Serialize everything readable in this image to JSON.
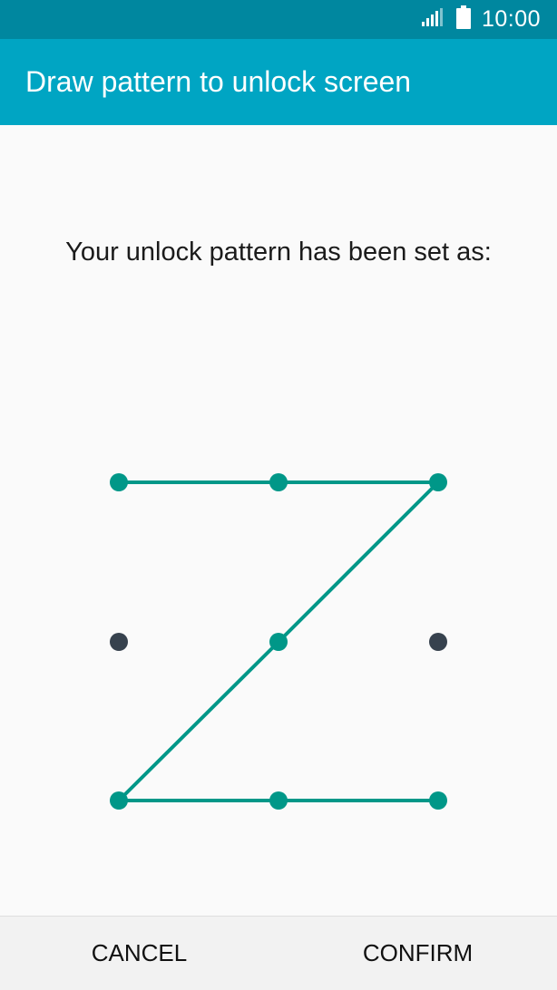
{
  "status_bar": {
    "time": "10:00",
    "icons": [
      "signal-icon",
      "battery-icon"
    ]
  },
  "app_bar": {
    "title": "Draw pattern to unlock screen"
  },
  "main": {
    "message": "Your unlock pattern has been set as:",
    "pattern": {
      "grid_size": 3,
      "sequence": [
        1,
        2,
        3,
        5,
        7,
        8,
        9
      ],
      "active_color": "#009788",
      "inactive_color": "#37424e"
    }
  },
  "buttons": {
    "cancel_label": "CANCEL",
    "confirm_label": "CONFIRM"
  }
}
